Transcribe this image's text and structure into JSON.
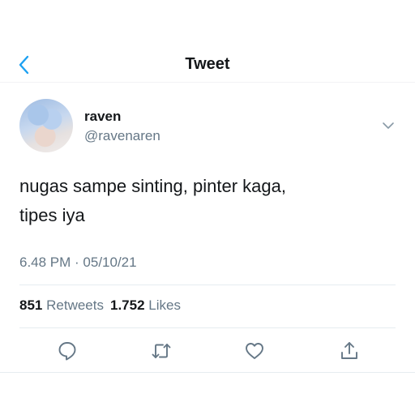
{
  "header": {
    "title": "Tweet",
    "back_icon": "chevron-left-icon",
    "accent": "#1da1f2"
  },
  "author": {
    "name": "raven",
    "handle": "@ravenaren",
    "avatar": "profile-photo"
  },
  "tweet": {
    "text_line1": "nugas sampe sinting, pinter kaga,",
    "text_line2": "tipes iya",
    "timestamp": "6.48 PM · 05/10/21"
  },
  "stats": {
    "retweets_count": "851",
    "retweets_label": "Retweets",
    "likes_count": "1.752",
    "likes_label": "Likes"
  },
  "actions": [
    "reply-icon",
    "retweet-icon",
    "like-icon",
    "share-icon"
  ],
  "colors": {
    "text": "#14171a",
    "secondary": "#657786",
    "divider": "#e6ecf0",
    "icon": "#657786"
  }
}
